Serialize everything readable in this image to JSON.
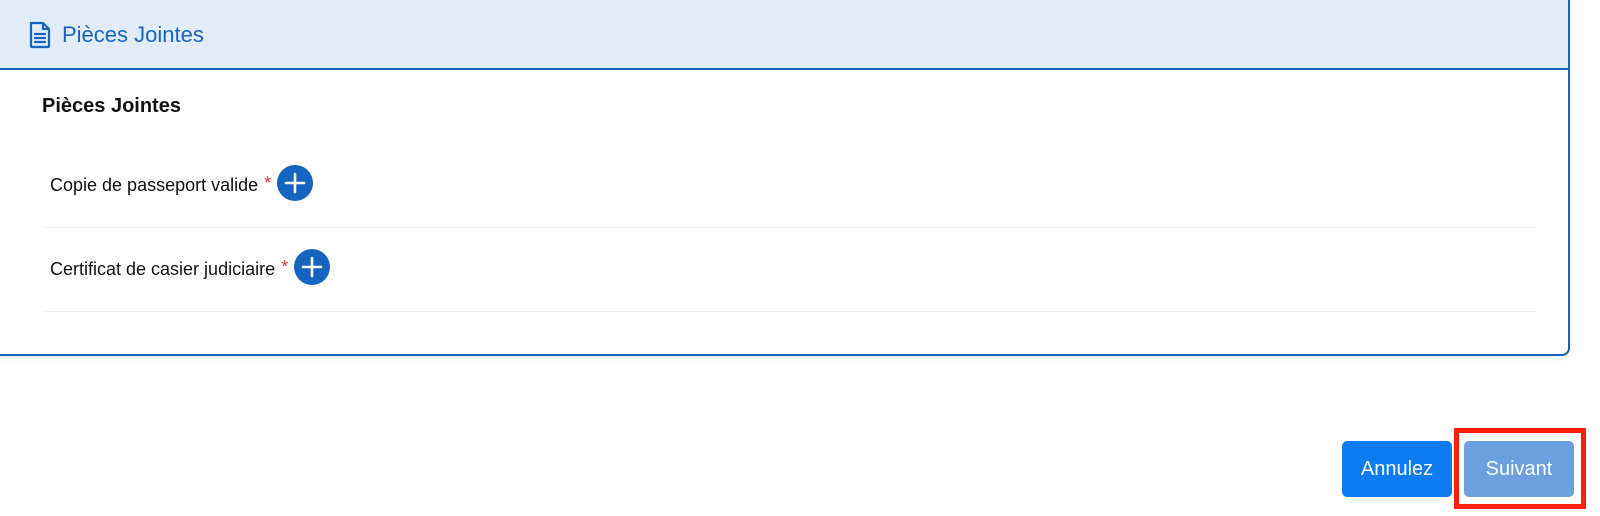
{
  "card": {
    "header_title": "Pièces Jointes",
    "header_icon": "document-icon",
    "section_title": "Pièces Jointes",
    "documents": [
      {
        "label": "Copie de passeport valide",
        "required_marker": "*",
        "add_icon": "plus-circle-icon"
      },
      {
        "label": "Certificat de casier judiciaire",
        "required_marker": "*",
        "add_icon": "plus-circle-icon"
      }
    ]
  },
  "actions": {
    "cancel_label": "Annulez",
    "next_label": "Suivant"
  },
  "colors": {
    "accent": "#1565c0",
    "header_bg": "#e1ecf8",
    "required": "#e53935",
    "cancel_button": "#0d7cf2",
    "next_button": "#6a9fe0",
    "highlight": "#ff1f0a"
  }
}
